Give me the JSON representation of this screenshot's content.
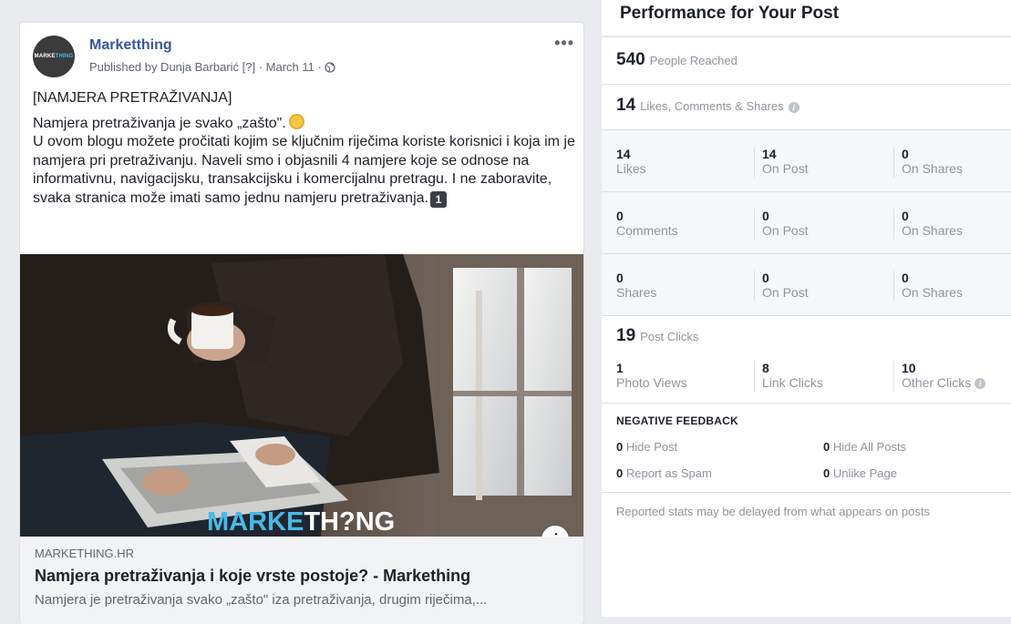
{
  "post": {
    "page_name": "Marketthing",
    "avatar_text_a": "MARKE",
    "avatar_text_b": "THING",
    "published": "Published by Dunja Barbarić [?] · March 11 ·",
    "more": "•••",
    "text_heading": "[NAMJERA PRETRAŽIVANJA]",
    "text_line1": "Namjera pretraživanja je svako „zašto\".",
    "text_body": "U ovom blogu možete pročitati kojim se ključnim riječima koriste korisnici i koja im je namjera pri pretraživanju. Naveli smo i objasnili 4 namjere koje se odnose na informativnu, navigacijsku, transakcijsku i komercijalnu pretragu. I ne zaboravite, svaka stranica može imati samo jednu namjeru pretraživanja.",
    "keycap": "1",
    "image_brand_a": "MARKE",
    "image_brand_b": "TH",
    "image_brand_c": "NG",
    "link": {
      "domain": "MARKETHING.HR",
      "title": "Namjera pretraživanja i koje vrste postoje? - Markething",
      "description": "Namjera je pretraživanja svako „zašto\" iza pretraživanja, drugim riječima,..."
    }
  },
  "insights": {
    "title": "Performance for Your Post",
    "reach": {
      "value": "540",
      "label": "People Reached"
    },
    "engagement": {
      "value": "14",
      "label": "Likes, Comments & Shares"
    },
    "rows": [
      {
        "cells": [
          {
            "n": "14",
            "l": "Likes"
          },
          {
            "n": "14",
            "l": "On Post"
          },
          {
            "n": "0",
            "l": "On Shares"
          }
        ]
      },
      {
        "cells": [
          {
            "n": "0",
            "l": "Comments"
          },
          {
            "n": "0",
            "l": "On Post"
          },
          {
            "n": "0",
            "l": "On Shares"
          }
        ]
      },
      {
        "cells": [
          {
            "n": "0",
            "l": "Shares"
          },
          {
            "n": "0",
            "l": "On Post"
          },
          {
            "n": "0",
            "l": "On Shares"
          }
        ]
      }
    ],
    "post_clicks": {
      "value": "19",
      "label": "Post Clicks"
    },
    "clicks": [
      {
        "n": "1",
        "l": "Photo Views"
      },
      {
        "n": "8",
        "l": "Link Clicks"
      },
      {
        "n": "10",
        "l": "Other Clicks"
      }
    ],
    "negative_feedback": {
      "title": "NEGATIVE FEEDBACK",
      "items": [
        {
          "n": "0",
          "l": "Hide Post"
        },
        {
          "n": "0",
          "l": "Hide All Posts"
        },
        {
          "n": "0",
          "l": "Report as Spam"
        },
        {
          "n": "0",
          "l": "Unlike Page"
        }
      ]
    },
    "footer": "Reported stats may be delayed from what appears on posts"
  },
  "colors": {
    "link_blue": "#385898",
    "muted": "#90949c",
    "background": "#e9ebee"
  }
}
